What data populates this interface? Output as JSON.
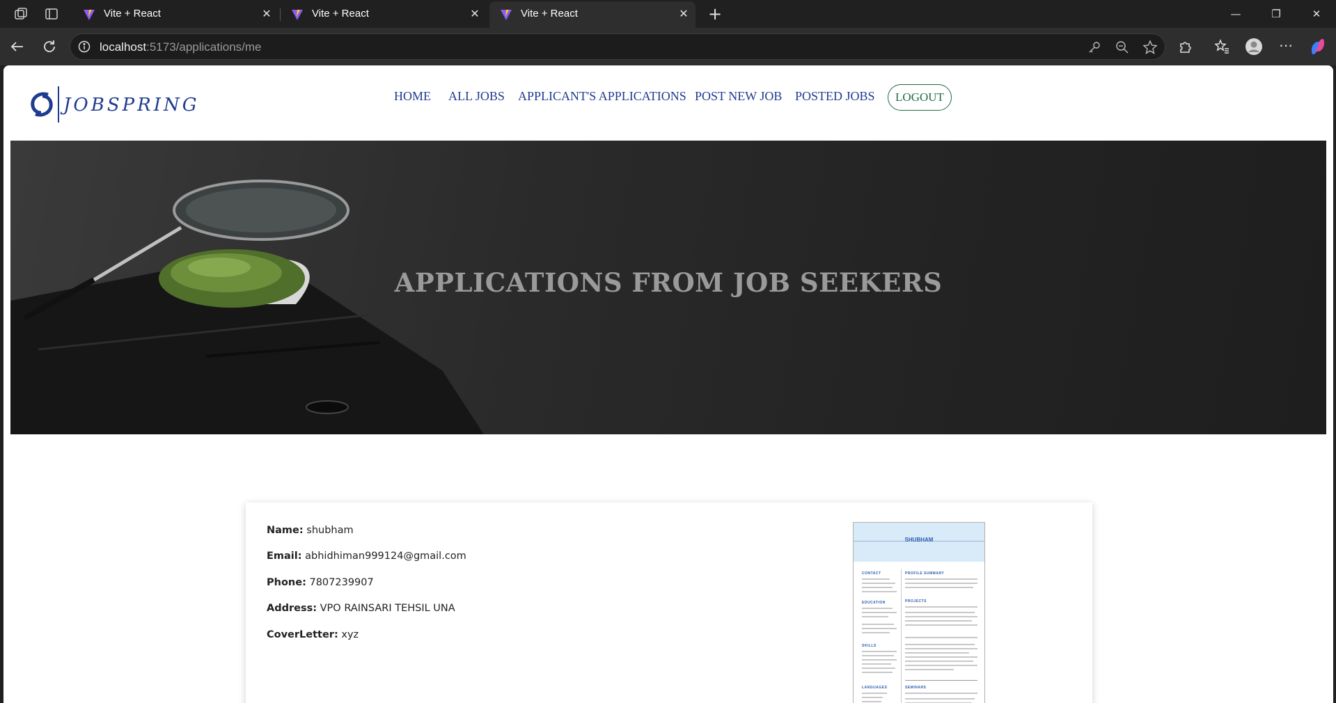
{
  "browser": {
    "tabs": [
      {
        "title": "Vite + React",
        "active": false
      },
      {
        "title": "Vite + React",
        "active": false
      },
      {
        "title": "Vite + React",
        "active": true
      }
    ],
    "url_host": "localhost",
    "url_path": ":5173/applications/me"
  },
  "site": {
    "logo_text": "JOBSPRING",
    "nav": {
      "home": "HOME",
      "all_jobs": "ALL JOBS",
      "applications": "APPLICANT'S APPLICATIONS",
      "post_job": "POST NEW JOB",
      "posted_jobs": "POSTED JOBS",
      "logout": "LOGOUT"
    },
    "hero_title": "APPLICATIONS FROM JOB SEEKERS"
  },
  "application": {
    "name_label": "Name:",
    "name": "shubham",
    "email_label": "Email:",
    "email": "abhidhiman999124@gmail.com",
    "phone_label": "Phone:",
    "phone": "7807239907",
    "address_label": "Address:",
    "address": "VPO RAINSARI TEHSIL UNA",
    "cover_label": "CoverLetter:",
    "cover": "xyz",
    "resume": {
      "name": "SHUBHAM",
      "sections_left": [
        "CONTACT",
        "EDUCATION",
        "SKILLS",
        "LANGUAGES"
      ],
      "sections_right": [
        "PROFILE SUMMARY",
        "PROJECTS",
        "SEMINARS"
      ]
    }
  },
  "colors": {
    "nav_blue": "#1f3b8f",
    "logout_green": "#1f6b40",
    "hero_text": "#9a9a9a"
  }
}
